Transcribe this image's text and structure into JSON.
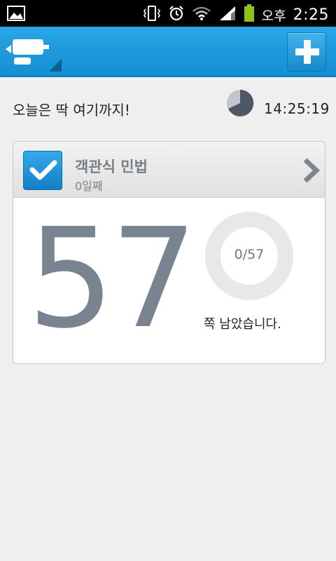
{
  "status_bar": {
    "ampm": "오후",
    "time": "2:25",
    "icons": [
      "image-icon",
      "vibrate-icon",
      "alarm-icon",
      "wifi-icon",
      "signal-icon",
      "battery-icon"
    ]
  },
  "action_bar": {
    "logo_icon": "desk-icon",
    "add_icon": "plus-icon"
  },
  "greeting": {
    "text": "오늘은 딱 여기까지!",
    "clock_time": "14:25:19",
    "clock_icon": "pie-clock-icon"
  },
  "card": {
    "title": "객관식 민법",
    "subtitle": "0일째",
    "count": "57",
    "progress_text": "0/57",
    "progress": {
      "done": 0,
      "total": 57
    },
    "remaining_text": "쪽 남았습니다.",
    "colors": {
      "accent": "#1a8fd6",
      "number": "#7a8491",
      "ring": "#e8e8e8"
    }
  }
}
